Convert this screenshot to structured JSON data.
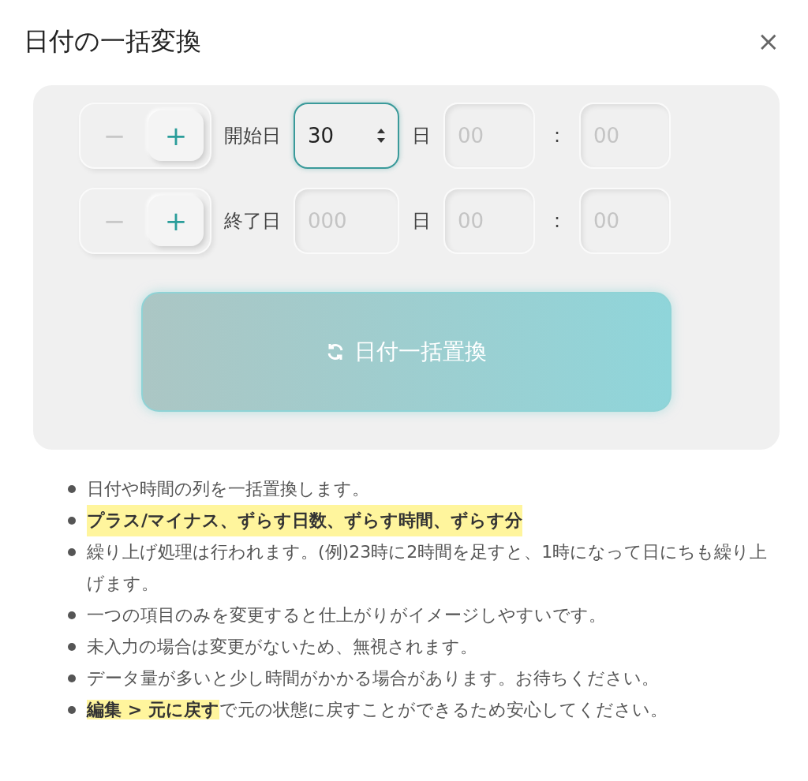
{
  "dialog": {
    "title": "日付の一括変換",
    "close": "×"
  },
  "rows": [
    {
      "sign": [
        {
          "label": "−",
          "selected": false
        },
        {
          "label": "+",
          "selected": true
        }
      ],
      "label": "開始日",
      "days": {
        "value": "30",
        "focused": true
      },
      "day_unit": "日",
      "hours": {
        "placeholder": "00"
      },
      "separator": ":",
      "minutes": {
        "placeholder": "00"
      }
    },
    {
      "sign": [
        {
          "label": "−",
          "selected": false
        },
        {
          "label": "+",
          "selected": true
        }
      ],
      "label": "終了日",
      "days": {
        "placeholder": "000",
        "focused": false
      },
      "day_unit": "日",
      "hours": {
        "placeholder": "00"
      },
      "separator": ":",
      "minutes": {
        "placeholder": "00"
      }
    }
  ],
  "action_button": {
    "label": "日付一括置換"
  },
  "notes": [
    {
      "text": "日付や時間の列を一括置換します。",
      "highlight": false
    },
    {
      "text": "プラス/マイナス、ずらす日数、ずらす時間、ずらす分",
      "highlight": true
    },
    {
      "text": "繰り上げ処理は行われます。(例)23時に2時間を足すと、1時になって日にちも繰り上げます。",
      "highlight": false
    },
    {
      "text": "一つの項目のみを変更すると仕上がりがイメージしやすいです。",
      "highlight": false
    },
    {
      "text": "未入力の場合は変更がないため、無視されます。",
      "highlight": false
    },
    {
      "text": "データ量が多いと少し時間がかかる場合があります。お待ちください。",
      "highlight": false
    },
    {
      "text": "**編集 > 元に戻す**で元の状態に戻すことができるため安心してください。",
      "highlight": false
    }
  ]
}
